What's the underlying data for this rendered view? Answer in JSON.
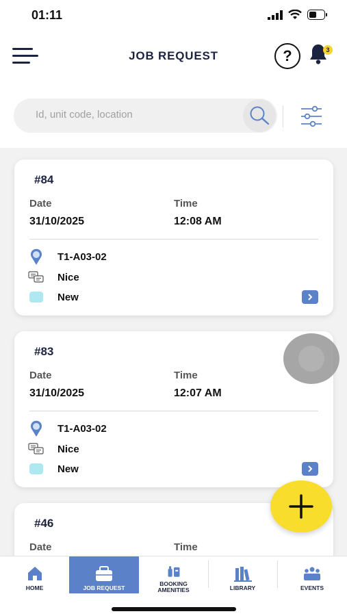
{
  "status_bar": {
    "time": "01:11"
  },
  "header": {
    "title": "JOB REQUEST",
    "help_symbol": "?",
    "notification_count": "3"
  },
  "search": {
    "placeholder": "Id, unit code, location",
    "value": ""
  },
  "cards": [
    {
      "id": "#84",
      "date_label": "Date",
      "date": "31/10/2025",
      "time_label": "Time",
      "time": "12:08 AM",
      "location": "T1-A03-02",
      "description": "Nice",
      "status": "New"
    },
    {
      "id": "#83",
      "date_label": "Date",
      "date": "31/10/2025",
      "time_label": "Time",
      "time": "12:07 AM",
      "location": "T1-A03-02",
      "description": "Nice",
      "status": "New"
    },
    {
      "id": "#46",
      "date_label": "Date",
      "time_label": "Time"
    }
  ],
  "nav": [
    {
      "label": "HOME",
      "icon": "home-icon"
    },
    {
      "label": "JOB REQUEST",
      "icon": "briefcase-icon",
      "active": true
    },
    {
      "label": "BOOKING",
      "label2": "AMENITIES",
      "icon": "booking-icon"
    },
    {
      "label": "LIBRARY",
      "icon": "books-icon"
    },
    {
      "label": "EVENTS",
      "icon": "events-icon"
    }
  ],
  "colors": {
    "accent": "#5b82c9",
    "fab": "#f8dd2c",
    "status_new": "#aee8f0",
    "navy": "#1c2340"
  }
}
